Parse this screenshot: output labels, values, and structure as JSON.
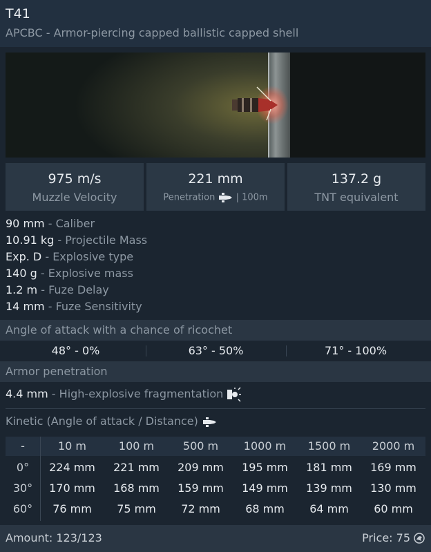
{
  "header": {
    "title": "T41",
    "subtitle": "APCBC - Armor-piercing capped ballistic capped shell"
  },
  "stats": [
    {
      "value": "975 m/s",
      "label": "Muzzle Velocity"
    },
    {
      "value": "221 mm",
      "label": "Penetration",
      "suffix": "| 100m"
    },
    {
      "value": "137.2 g",
      "label": "TNT equivalent"
    }
  ],
  "properties": [
    {
      "value": "90 mm",
      "label": "- Caliber"
    },
    {
      "value": "10.91 kg",
      "label": "- Projectile Mass"
    },
    {
      "value": "Exp. D",
      "label": "- Explosive type"
    },
    {
      "value": "140 g",
      "label": "- Explosive mass"
    },
    {
      "value": "1.2 m",
      "label": "- Fuze Delay"
    },
    {
      "value": "14 mm",
      "label": "- Fuze Sensitivity"
    }
  ],
  "ricochet": {
    "title": "Angle of attack with a chance of ricochet",
    "cells": [
      "48° - 0%",
      "63° - 50%",
      "71° - 100%"
    ]
  },
  "armor": {
    "title": "Armor penetration",
    "he_value": "4.4 mm",
    "he_label": "- High-explosive fragmentation",
    "kinetic_title": "Kinetic (Angle of attack / Distance)"
  },
  "penetration_table": {
    "headers": [
      "-",
      "10 m",
      "100 m",
      "500 m",
      "1000 m",
      "1500 m",
      "2000 m"
    ],
    "rows": [
      {
        "angle": "0°",
        "values": [
          "224 mm",
          "221 mm",
          "209 mm",
          "195 mm",
          "181 mm",
          "169 mm"
        ]
      },
      {
        "angle": "30°",
        "values": [
          "170 mm",
          "168 mm",
          "159 mm",
          "149 mm",
          "139 mm",
          "130 mm"
        ]
      },
      {
        "angle": "60°",
        "values": [
          "76 mm",
          "75 mm",
          "72 mm",
          "68 mm",
          "64 mm",
          "60 mm"
        ]
      }
    ]
  },
  "footer": {
    "amount": "Amount: 123/123",
    "price": "Price: 75"
  },
  "colors": {
    "background": "#1b2530",
    "panel": "#2b3845",
    "text_bright": "#e6eaee",
    "text_dim": "#8d98a3"
  },
  "icons": {
    "penetration": "shell-icon",
    "he": "explosion-icon",
    "kinetic": "shell-icon",
    "price": "silver-lion-icon"
  }
}
